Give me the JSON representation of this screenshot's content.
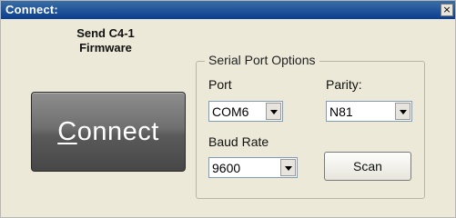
{
  "window": {
    "title": "Connect:",
    "close_glyph": "×"
  },
  "left": {
    "send_label_line1": "Send C4-1",
    "send_label_line2": "Firmware",
    "connect_button": {
      "mnemonic": "C",
      "rest": "onnect"
    }
  },
  "serial": {
    "group_title": "Serial Port Options",
    "port_label": "Port",
    "port_value": "COM6",
    "parity_label": "Parity:",
    "parity_value": "N81",
    "baud_label": "Baud Rate",
    "baud_value": "9600",
    "scan_label": "Scan"
  },
  "colors": {
    "titlebar": "#0a3d8f",
    "window_bg": "#ece9d8",
    "connect_button_bg": "#6f6f6f"
  },
  "icons": {
    "close": "close-icon",
    "dropdown": "chevron-down-icon"
  }
}
